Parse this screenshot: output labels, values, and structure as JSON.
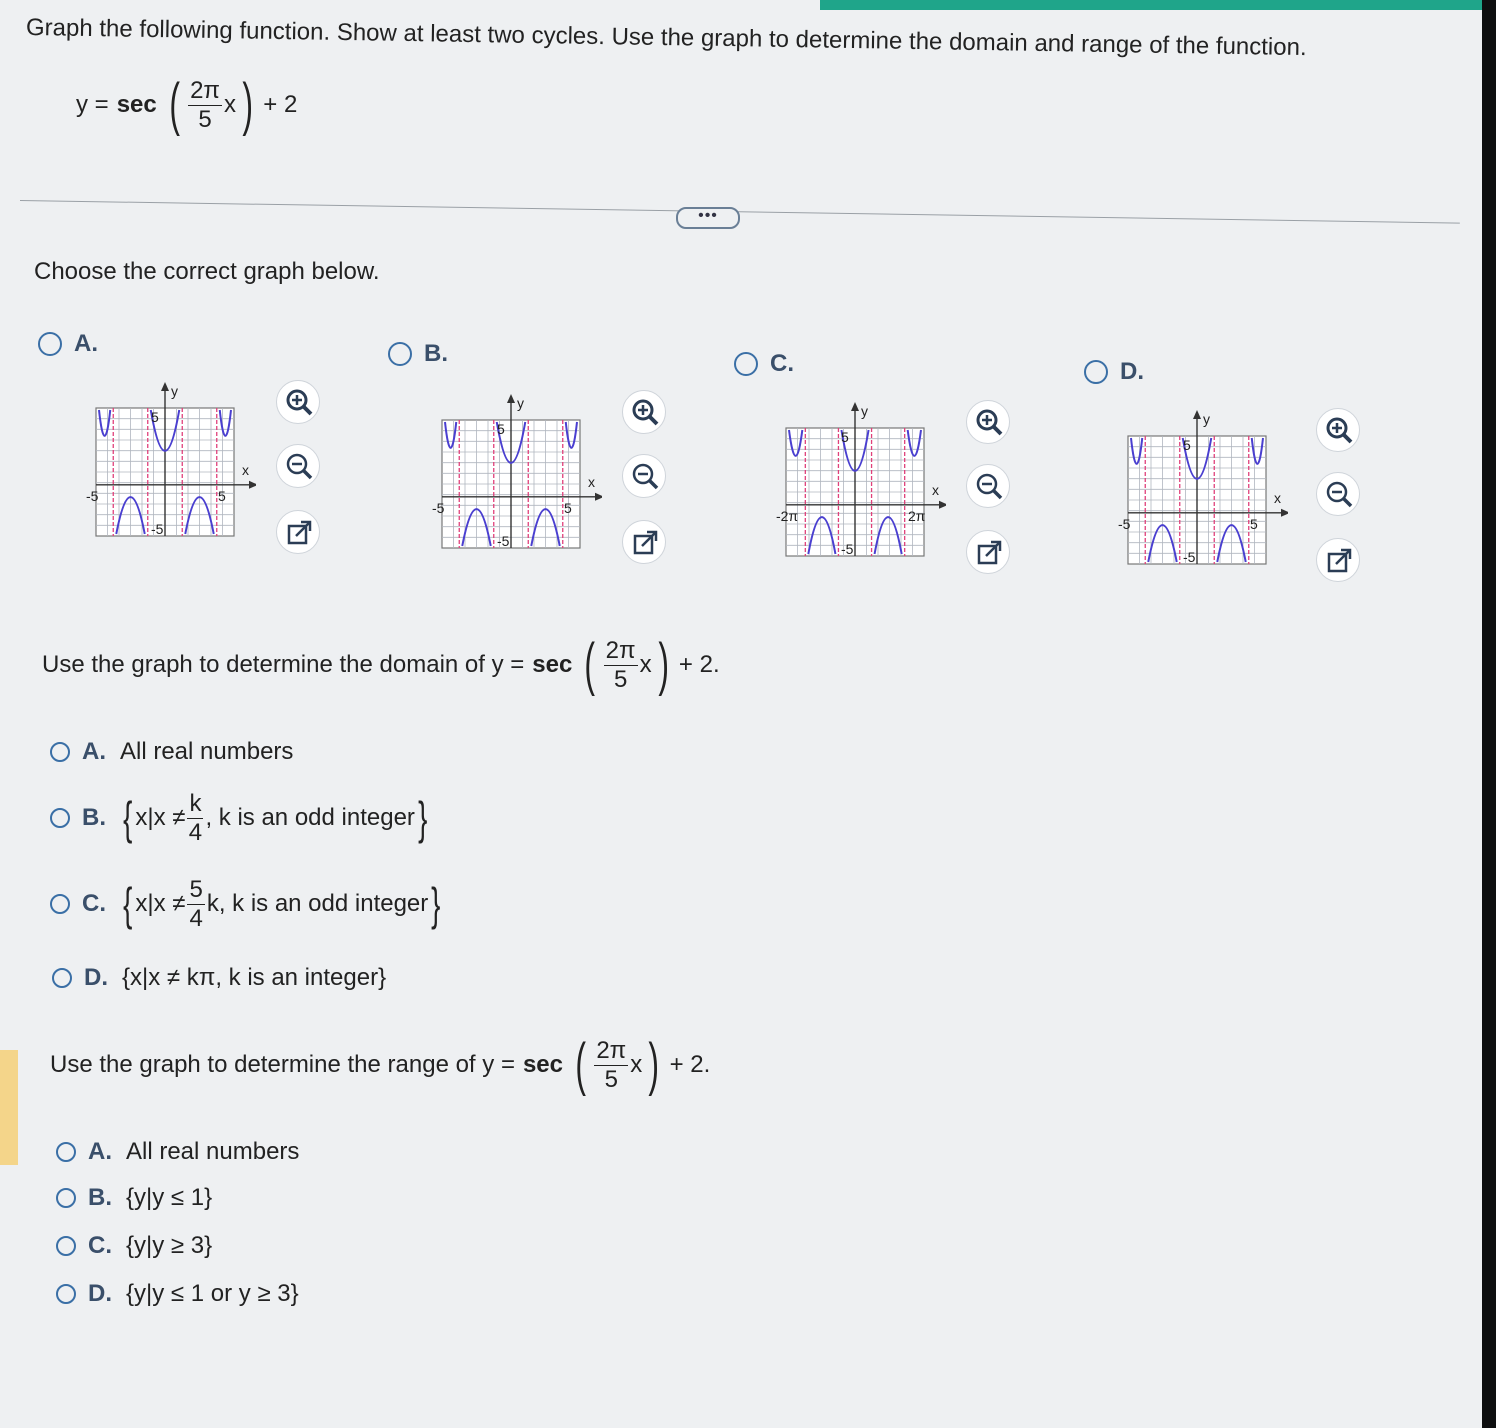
{
  "instructions": "Graph the following function. Show at least two cycles. Use the graph to determine the domain and range of the function.",
  "equation": {
    "lhs": "y =",
    "func": "sec",
    "num": "2π",
    "den": "5",
    "var": "x",
    "tail": "+ 2"
  },
  "more_label": "•••",
  "choose_graph": "Choose the correct graph below.",
  "graph_options": [
    {
      "label": "A.",
      "y_label": "y",
      "x_label": "x",
      "top": "5",
      "bottom": "-5",
      "left": "-5",
      "right": "5"
    },
    {
      "label": "B.",
      "y_label": "y",
      "x_label": "x",
      "top": "5",
      "bottom": "-5",
      "left": "-5",
      "right": "5"
    },
    {
      "label": "C.",
      "y_label": "y",
      "x_label": "x",
      "top": "5",
      "bottom": "-5",
      "left": "-2π",
      "right": "2π"
    },
    {
      "label": "D.",
      "y_label": "y",
      "x_label": "x",
      "top": "5",
      "bottom": "-5",
      "left": "-5",
      "right": "5"
    }
  ],
  "domain_question": {
    "prefix": "Use the graph to determine the domain of y =",
    "func": "sec",
    "num": "2π",
    "den": "5",
    "var": "x",
    "tail": "+ 2."
  },
  "domain_options": [
    {
      "label": "A.",
      "text": "All real numbers"
    },
    {
      "label": "B.",
      "open": "{",
      "set_start": "x|x ≠",
      "num": "k",
      "den": "4",
      "after": ", k is an odd integer",
      "close": "}"
    },
    {
      "label": "C.",
      "open": "{",
      "set_start": "x|x ≠",
      "num": "5",
      "den": "4",
      "after": "k, k is an odd integer",
      "close": "}"
    },
    {
      "label": "D.",
      "text": "{x|x ≠ kπ, k is an integer}"
    }
  ],
  "range_question": {
    "prefix": "Use the graph to determine the range of y =",
    "func": "sec",
    "num": "2π",
    "den": "5",
    "var": "x",
    "tail": "+ 2."
  },
  "range_options": [
    {
      "label": "A.",
      "text": "All real numbers"
    },
    {
      "label": "B.",
      "text": "{y|y ≤ 1}"
    },
    {
      "label": "C.",
      "text": "{y|y ≥ 3}"
    },
    {
      "label": "D.",
      "text": "{y|y ≤ 1 or y ≥ 3}"
    }
  ],
  "colors": {
    "accent": "#1fa58a",
    "radio": "#3a6fa6",
    "curve": "#4a3fd0",
    "asymptote": "#e0407a",
    "grid": "#b0b6bf"
  },
  "icons": [
    "zoom-in-icon",
    "zoom-out-icon",
    "open-new-window-icon"
  ]
}
